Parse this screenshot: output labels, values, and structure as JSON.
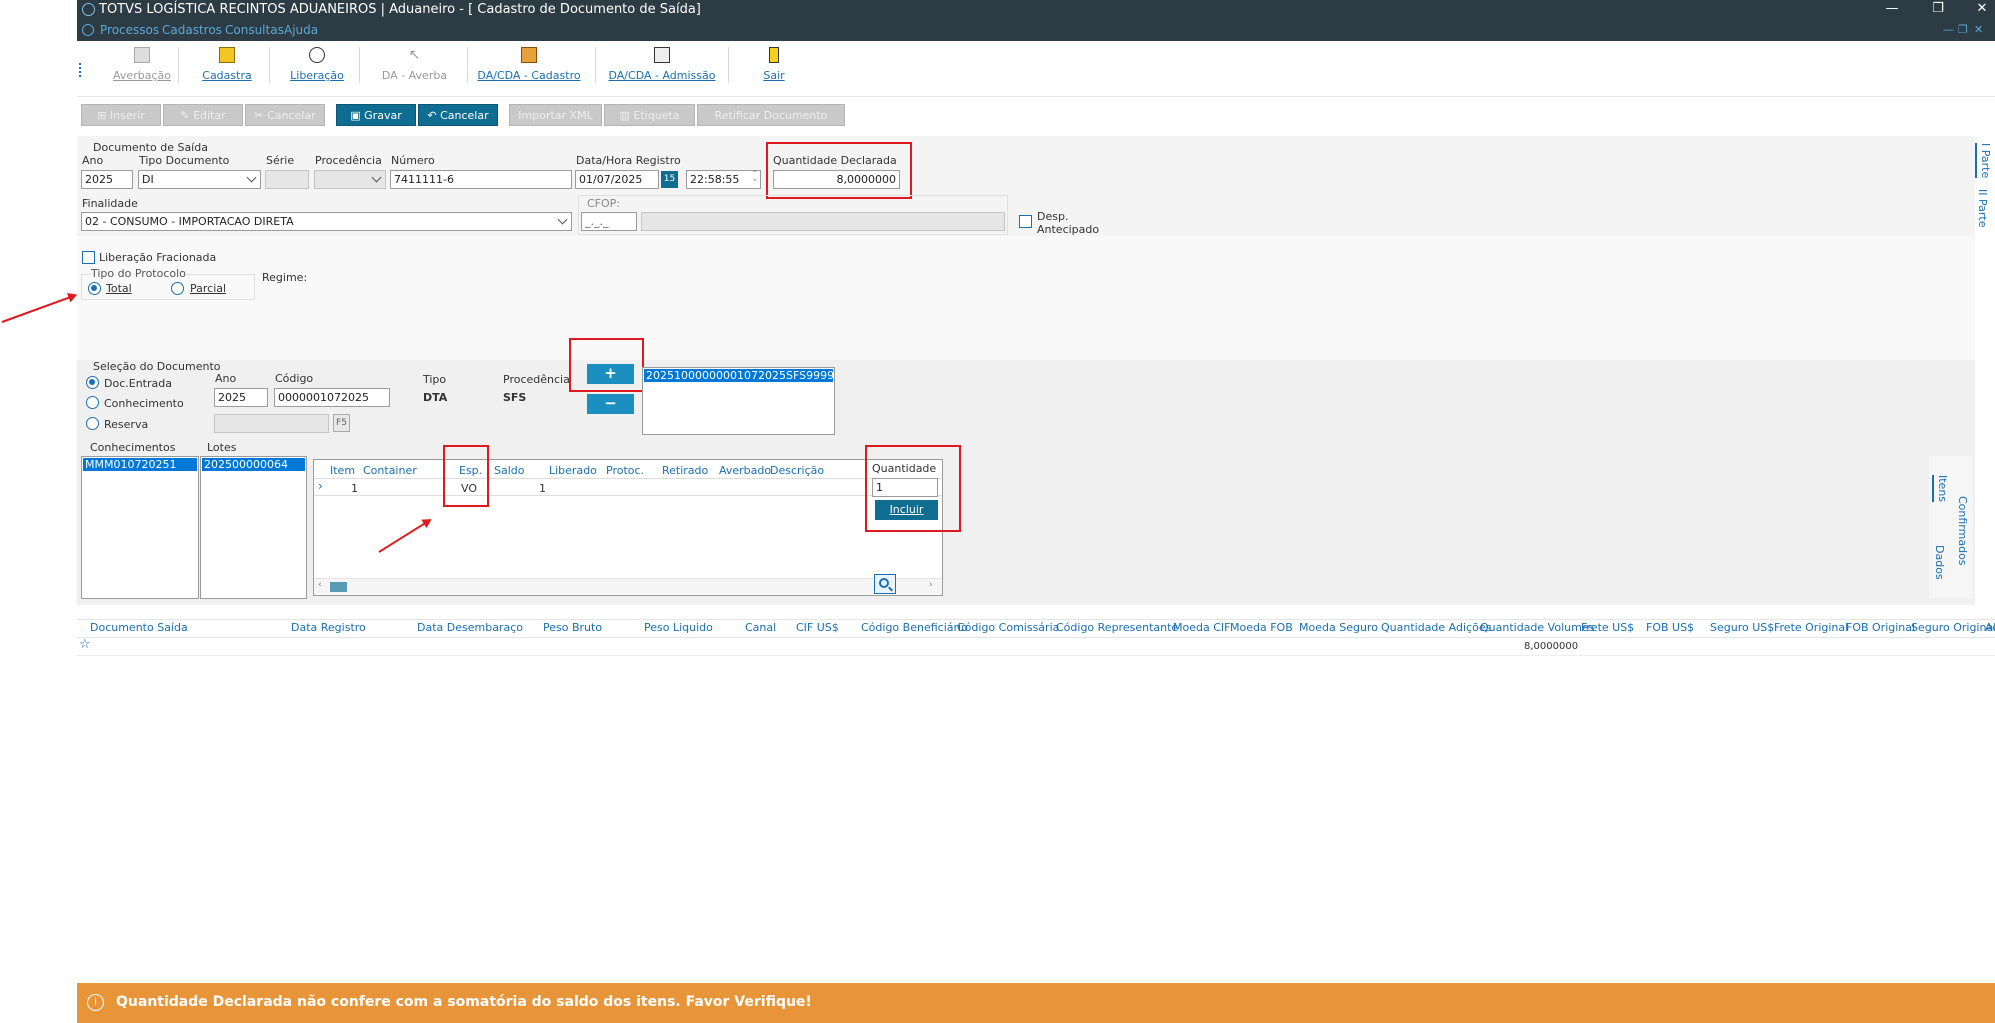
{
  "window": {
    "title": "TOTVS LOGÍSTICA RECINTOS ADUANEIROS | Aduaneiro - [ Cadastro de Documento de Saída]"
  },
  "menu": [
    "Processos",
    "Cadastros",
    "Consultas",
    "Ajuda"
  ],
  "toolbar": [
    "Averbação",
    "Cadastra",
    "Liberação",
    "DA - Averba",
    "DA/CDA - Cadastro",
    "DA/CDA - Admissão",
    "Sair"
  ],
  "buttons": {
    "inserir": "Inserir",
    "editar": "Editar",
    "cancelar1": "Cancelar",
    "gravar": "Gravar",
    "cancelar2": "Cancelar",
    "importar_xml": "Importar XML",
    "etiqueta": "Etiqueta",
    "retificar": "Retificar Documento"
  },
  "doc": {
    "section": "Documento de Saída",
    "ano_label": "Ano",
    "ano": "2025",
    "tipo_label": "Tipo Documento",
    "tipo": "DI",
    "serie_label": "Série",
    "procedencia_label": "Procedência",
    "numero_label": "Número",
    "numero": "7411111-6",
    "datahora_label": "Data/Hora Registro",
    "data": "01/07/2025",
    "cal_btn": "15",
    "hora": "22:58:55",
    "qtd_label": "Quantidade Declarada",
    "qtd": "8,0000000",
    "finalidade_label": "Finalidade",
    "finalidade": "02 - CONSUMO - IMPORTACAO DIRETA",
    "cfop_label": "CFOP:",
    "cfop": "_._._",
    "desp_label1": "Desp.",
    "desp_label2": "Antecipado",
    "lib_frac": "Liberação Fracionada",
    "tipo_protocolo": "Tipo do Protocolo",
    "total": "Total",
    "parcial": "Parcial",
    "regime": "Regime:"
  },
  "right_tabs": [
    "I Parte",
    "II Parte"
  ],
  "selecao": {
    "section": "Seleção do Documento",
    "opt1": "Doc.Entrada",
    "opt2": "Conhecimento",
    "opt3": "Reserva",
    "ano_label": "Ano",
    "ano": "2025",
    "codigo_label": "Código",
    "codigo": "0000001072025",
    "tipo_label": "Tipo",
    "tipo": "DTA",
    "proc_label": "Procedência",
    "proc": "SFS",
    "f5": "F5",
    "plus": "+",
    "minus": "−",
    "selected_doc": "20251000000001072025SFS999999"
  },
  "conhecimentos": {
    "label": "Conhecimentos",
    "items": [
      "MMM010720251"
    ]
  },
  "lotes": {
    "label": "Lotes",
    "items": [
      "202500000064"
    ]
  },
  "items_grid": {
    "headers": [
      "Item",
      "Container",
      "Esp.",
      "Saldo",
      "Liberado",
      "Protoc.",
      "Retirado",
      "Averbado",
      "Descrição"
    ],
    "row": {
      "item": "1",
      "container": "",
      "esp": "VO",
      "saldo": "1"
    }
  },
  "quantidade": {
    "label": "Quantidade",
    "value": "1",
    "incluir": "Incluir"
  },
  "side_tabs": [
    "Itens",
    "Dados",
    "Confirmados"
  ],
  "bottom_grid": {
    "headers": [
      "Documento Saída",
      "Data Registro",
      "Data Desembaraço",
      "Peso Bruto",
      "Peso Liquido",
      "Canal",
      "CIF US$",
      "Código Beneficiário",
      "Código Comissária",
      "Código Representante",
      "Moeda CIF",
      "Moeda FOB",
      "Moeda Seguro",
      "Quantidade Adições",
      "Quantidade Volumes",
      "Frete US$",
      "FOB US$",
      "Seguro US$",
      "Frete Original",
      "FOB Original",
      "Seguro Original",
      "Ad"
    ],
    "qtd_volumes": "8,0000000"
  },
  "message": "Quantidade Declarada não confere com a somatória do saldo dos itens. Favor Verifique!"
}
